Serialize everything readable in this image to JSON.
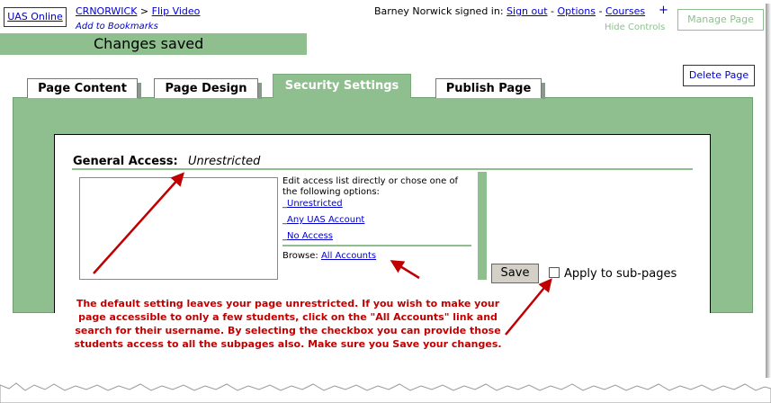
{
  "header": {
    "site_button": "UAS Online",
    "breadcrumb_root": "CRNORWICK",
    "breadcrumb_sep": " > ",
    "breadcrumb_page": "Flip Video",
    "bookmark": "Add to Bookmarks",
    "signed_in": "Barney Norwick signed in: ",
    "sign_out": "Sign out",
    "options": "Options",
    "courses": "Courses",
    "plus": "+",
    "dash": " - ",
    "hide_controls": "Hide Controls",
    "manage_page": "Manage Page"
  },
  "status": {
    "saved": "Changes saved"
  },
  "delete_page": "Delete Page",
  "tabs": [
    {
      "label": "Page Content"
    },
    {
      "label": "Page Design"
    },
    {
      "label": "Security Settings"
    },
    {
      "label": "Publish Page"
    }
  ],
  "security": {
    "general_access_label": "General Access:",
    "general_access_value": "Unrestricted",
    "edit_text": "Edit access list directly or chose one of the following options:",
    "opt_prefix": "_",
    "opt_unrestricted": "Unrestricted",
    "opt_any_account": "Any UAS Account",
    "opt_no_access": "No Access",
    "browse_label": "Browse: ",
    "browse_link": "All Accounts",
    "save": "Save",
    "apply_sub": "Apply to sub-pages"
  },
  "annotation": "The default setting leaves your page unrestricted. If you wish to make your page accessible to only a few students, click on the \"All Accounts\" link and search for their username. By selecting the checkbox you can provide those students access to all the subpages also. Make sure you Save your changes.",
  "colors": {
    "panel_green": "#8fbf8f",
    "annotation_red": "#c00000",
    "link_blue": "#0000cc"
  }
}
